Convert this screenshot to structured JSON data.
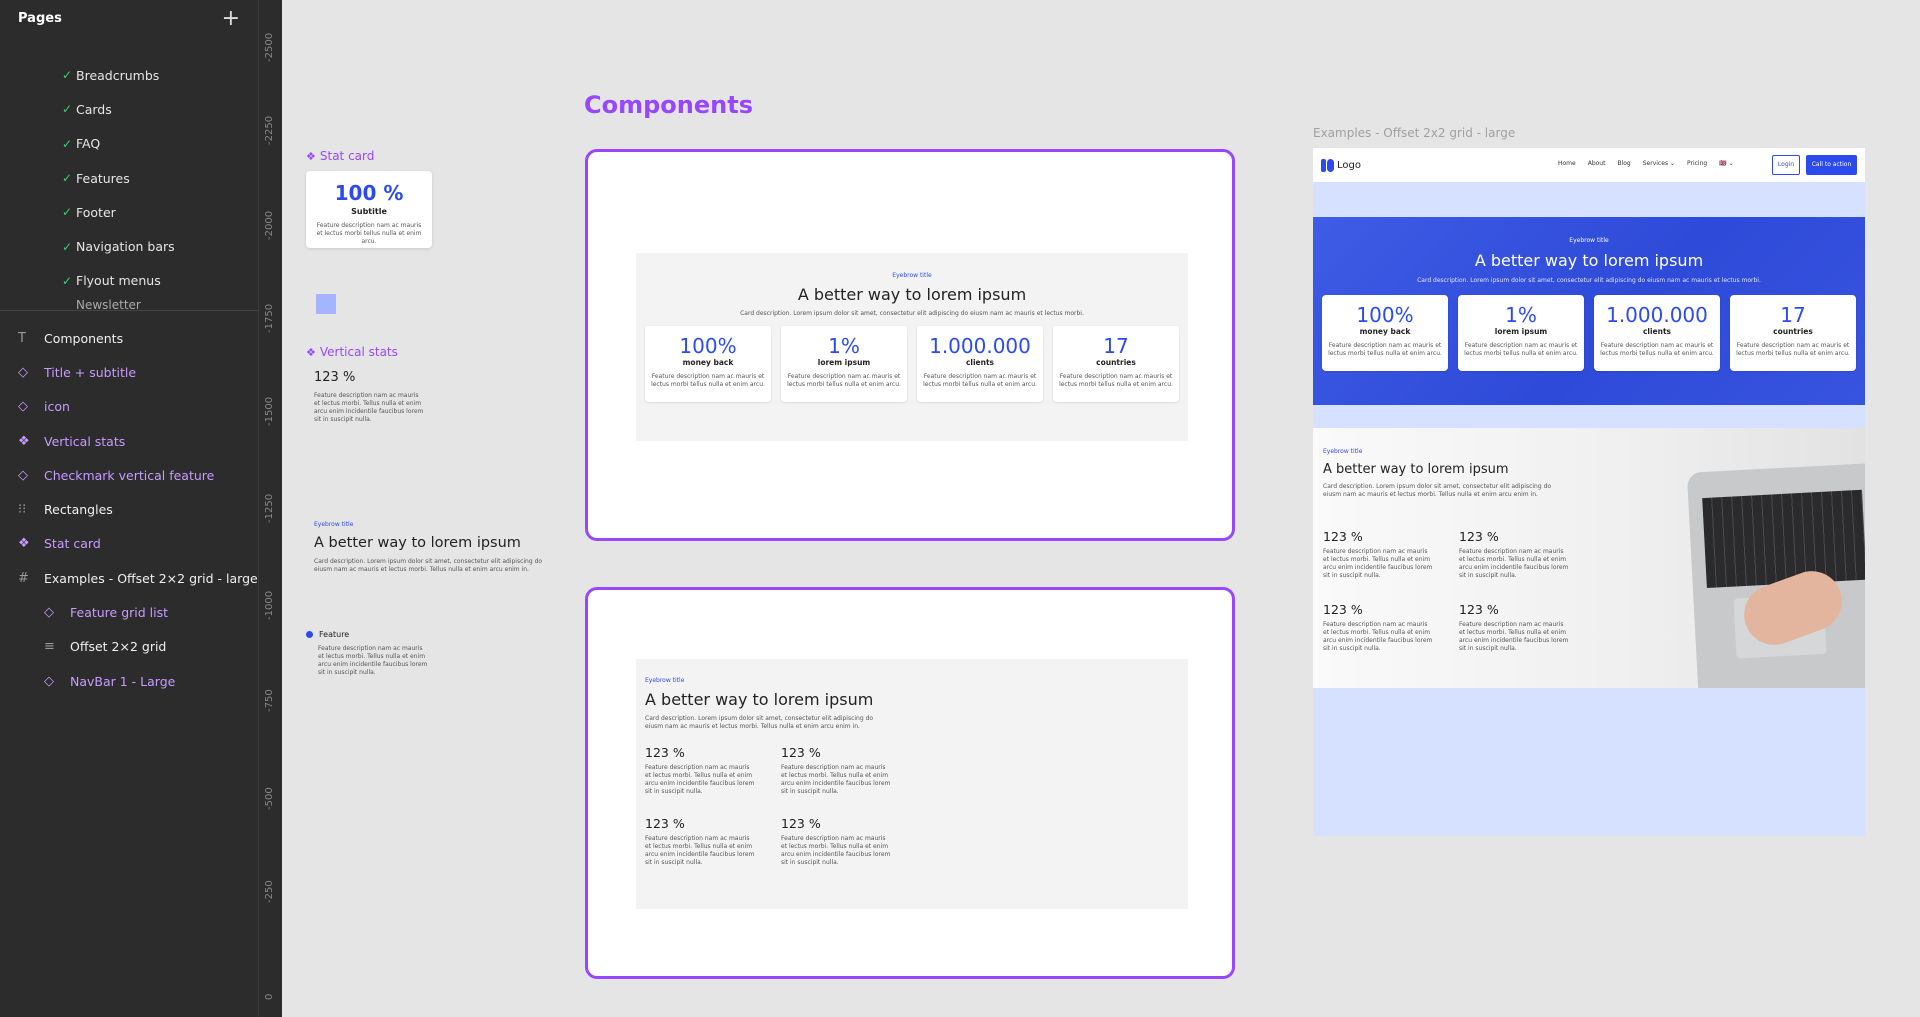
{
  "sidebar": {
    "pages_title": "Pages",
    "add_icon": "plus-icon",
    "cut_top": "",
    "pages": [
      {
        "label": "Breadcrumbs"
      },
      {
        "label": "Cards"
      },
      {
        "label": "FAQ"
      },
      {
        "label": "Features"
      },
      {
        "label": "Footer"
      },
      {
        "label": "Navigation bars"
      },
      {
        "label": "Flyout menus"
      }
    ],
    "cut_bottom": "Newsletter",
    "layers": [
      {
        "icon": "T",
        "label": "Components"
      },
      {
        "icon": "◇",
        "label": "Title + subtitle"
      },
      {
        "icon": "◇",
        "label": "icon"
      },
      {
        "icon": "❖",
        "label": "Vertical stats"
      },
      {
        "icon": "◇",
        "label": "Checkmark vertical feature"
      },
      {
        "icon": "⁝⁝",
        "label": "Rectangles"
      },
      {
        "icon": "❖",
        "label": "Stat card"
      },
      {
        "icon": "#",
        "label": "Examples - Offset 2×2 grid - large"
      },
      {
        "icon": "◇",
        "label": "Feature grid list"
      },
      {
        "icon": "≡",
        "label": "Offset 2×2 grid"
      },
      {
        "icon": "◇",
        "label": "NavBar 1 - Large"
      }
    ]
  },
  "ruler": {
    "ticks": [
      "-2500",
      "-2250",
      "-2000",
      "-1750",
      "-1500",
      "-1250",
      "-1000",
      "-750",
      "-500",
      "-250",
      "0"
    ]
  },
  "canvas": {
    "stat_card_label": "Stat card",
    "stat_card": {
      "num": "100 %",
      "sub": "Subtitle",
      "desc": "Feature description nam ac mauris et lectus morbi tellus nulla et enim arcu."
    },
    "vertical_stats_label": "Vertical stats",
    "vertical_stats": {
      "num": "123 %",
      "desc": "Feature description nam ac mauris et lectus morbi. Tellus nulla et enim arcu enim incidentile faucibus lorem sit in suscipit nulla."
    },
    "title_subtitle": {
      "eyebrow": "Eyebrow title",
      "title": "A better way to lorem ipsum",
      "desc": "Card description. Lorem ipsum dolor sit amet, consectetur elit adipiscing do eiusm nam ac mauris et lectus morbi. Tellus nulla et enim arcu enim in."
    },
    "feature": {
      "label": "Feature",
      "desc": "Feature description nam ac mauris et lectus morbi. Tellus nulla et enim arcu enim incidentile faucibus lorem sit in suscipit nulla."
    },
    "components_title": "Components",
    "frame1": {
      "eyebrow": "Eyebrow title",
      "title": "A better way to lorem ipsum",
      "desc": "Card description. Lorem ipsum dolor sit amet, consectetur elit adipiscing do eiusm nam ac mauris et lectus morbi.",
      "cards": [
        {
          "num": "100%",
          "sub": "money back",
          "desc": "Feature description nam ac mauris et lectus morbi tellus nulla et enim arcu."
        },
        {
          "num": "1%",
          "sub": "lorem ipsum",
          "desc": "Feature description nam ac mauris et lectus morbi tellus nulla et enim arcu."
        },
        {
          "num": "1.000.000",
          "sub": "clients",
          "desc": "Feature description nam ac mauris et lectus morbi tellus nulla et enim arcu."
        },
        {
          "num": "17",
          "sub": "countries",
          "desc": "Feature description nam ac mauris et lectus morbi tellus nulla et enim arcu."
        }
      ]
    },
    "frame2": {
      "eyebrow": "Eyebrow title",
      "title": "A better way to lorem ipsum",
      "desc": "Card description. Lorem ipsum dolor sit amet, consectetur elit adipiscing do eiusm nam ac mauris et lectus morbi. Tellus nulla et enim arcu enim in.",
      "stats": [
        {
          "num": "123 %",
          "desc": "Feature description nam ac mauris et lectus morbi. Tellus nulla et enim arcu enim incidentile faucibus lorem sit in suscipit nulla."
        },
        {
          "num": "123 %",
          "desc": "Feature description nam ac mauris et lectus morbi. Tellus nulla et enim arcu enim incidentile faucibus lorem sit in suscipit nulla."
        },
        {
          "num": "123 %",
          "desc": "Feature description nam ac mauris et lectus morbi. Tellus nulla et enim arcu enim incidentile faucibus lorem sit in suscipit nulla."
        },
        {
          "num": "123 %",
          "desc": "Feature description nam ac mauris et lectus morbi. Tellus nulla et enim arcu enim incidentile faucibus lorem sit in suscipit nulla."
        }
      ]
    },
    "example_label": "Examples - Offset 2x2 grid - large",
    "example": {
      "logo": "Logo",
      "menu": [
        "Home",
        "About",
        "Blog",
        "Services ⌄",
        "Pricing",
        "🇬🇧 ⌄"
      ],
      "login": "Login",
      "cta": "Call to action",
      "hero": {
        "eyebrow": "Eyebrow title",
        "title": "A better way to lorem ipsum",
        "desc": "Card description. Lorem ipsum dolor sit amet, consectetur elit adipiscing do eiusm nam ac mauris et lectus morbi.",
        "cards": [
          {
            "num": "100%",
            "sub": "money back",
            "desc": "Feature description nam ac mauris et lectus morbi tellus nulla et enim arcu."
          },
          {
            "num": "1%",
            "sub": "lorem ipsum",
            "desc": "Feature description nam ac mauris et lectus morbi tellus nulla et enim arcu."
          },
          {
            "num": "1.000.000",
            "sub": "clients",
            "desc": "Feature description nam ac mauris et lectus morbi tellus nulla et enim arcu."
          },
          {
            "num": "17",
            "sub": "countries",
            "desc": "Feature description nam ac mauris et lectus morbi tellus nulla et enim arcu."
          }
        ]
      },
      "features": {
        "eyebrow": "Eyebrow title",
        "title": "A better way to lorem ipsum",
        "desc": "Card description. Lorem ipsum dolor sit amet, consectetur elit adipiscing do eiusm nam ac mauris et lectus morbi. Tellus nulla et enim arcu enim in.",
        "stats": [
          {
            "num": "123 %",
            "desc": "Feature description nam ac mauris et lectus morbi. Tellus nulla et enim arcu enim incidentile faucibus lorem sit in suscipit nulla."
          },
          {
            "num": "123 %",
            "desc": "Feature description nam ac mauris et lectus morbi. Tellus nulla et enim arcu enim incidentile faucibus lorem sit in suscipit nulla."
          },
          {
            "num": "123 %",
            "desc": "Feature description nam ac mauris et lectus morbi. Tellus nulla et enim arcu enim incidentile faucibus lorem sit in suscipit nulla."
          },
          {
            "num": "123 %",
            "desc": "Feature description nam ac mauris et lectus morbi. Tellus nulla et enim arcu enim incidentile faucibus lorem sit in suscipit nulla."
          }
        ]
      }
    }
  },
  "colors": {
    "accent": "#9747ff",
    "brand_blue": "#2c4bef",
    "sidebar_bg": "#2c2c2c",
    "check_green": "#35d17a"
  }
}
